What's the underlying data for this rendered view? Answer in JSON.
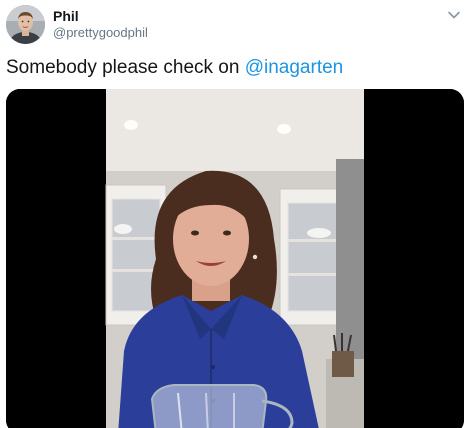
{
  "tweet": {
    "author": {
      "display_name": "Phil",
      "handle": "@prettygoodphil"
    },
    "text_prefix": "Somebody please check on ",
    "mention": "@inagarten"
  },
  "icons": {
    "more": "chevron-down-icon"
  },
  "colors": {
    "text_primary": "#14171a",
    "text_secondary": "#657786",
    "link": "#1b95e0",
    "media_background": "#000000"
  }
}
